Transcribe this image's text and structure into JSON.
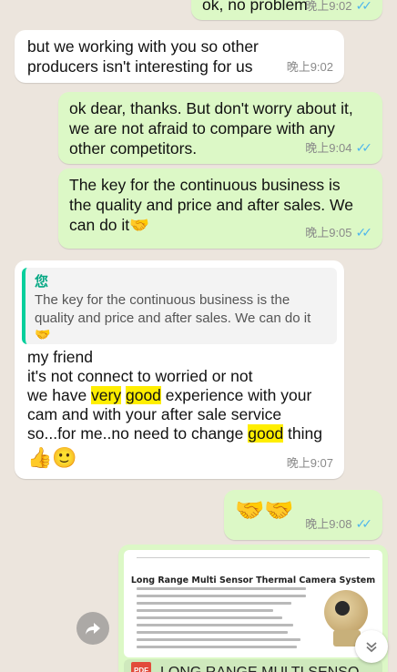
{
  "messages": [
    {
      "id": "m1",
      "text": "ok, no problem",
      "time": "晚上9:02"
    },
    {
      "id": "m2",
      "text": "but we working with you so other\nproducers isn't interesting for us",
      "time": "晚上9:02"
    },
    {
      "id": "m3",
      "text": "ok dear, thanks. But don't worry about it,\nwe are not afraid to  compare with any\nother competitors.",
      "time": "晚上9:04"
    },
    {
      "id": "m4",
      "text": "The key for the continuous business is\nthe quality and price and after sales. We\ncan do it",
      "emoji": "🤝",
      "time": "晚上9:05"
    },
    {
      "id": "m5",
      "quote": {
        "author": "您",
        "text": "The key for the continuous business is the\nquality and price and after sales. We can do it",
        "emoji": "🤝"
      },
      "lines": {
        "l1": "my friend",
        "l2": "it's not connect to worried or not",
        "l3a": "we have ",
        "l3b": "very",
        "l3c": " ",
        "l3d": "good",
        "l3e": " experience with your",
        "l4": "cam and with your after sale service",
        "l5a": "so...for me..no need to change ",
        "l5b": "good",
        "l5c": " thing"
      },
      "emoji": "👍🙂",
      "time": "晚上9:07"
    },
    {
      "id": "m6",
      "emoji": "🤝🤝",
      "time": "晚上9:08"
    },
    {
      "id": "m7",
      "doc_title": "Long Range Multi Sensor Thermal Camera System",
      "pdf_label": "PDF",
      "filename": "LONG RANGE MULTI SENSO..."
    }
  ],
  "icons": {
    "forward": "forward-icon",
    "scroll_down": "chevron-down-icon",
    "read_ticks": "double-check-icon"
  },
  "colors": {
    "outgoing": "#dcf8c6",
    "incoming": "#ffffff",
    "background": "#ece5dd",
    "ticks": "#4fb6ec",
    "highlight": "#ffee00",
    "quote_accent": "#06cf9c"
  }
}
